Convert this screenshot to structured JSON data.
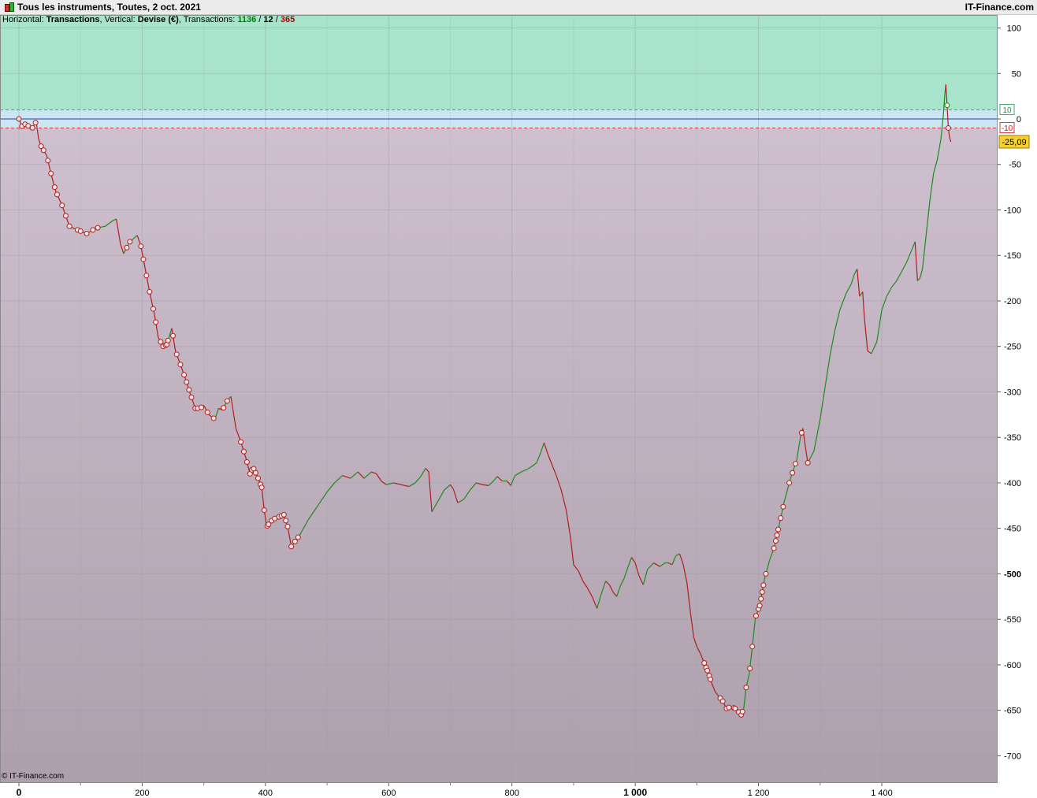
{
  "window": {
    "title": "Tous les instruments, Toutes, 2 oct. 2021",
    "brand": "IT-Finance.com",
    "copyright": "© IT-Finance.com"
  },
  "header": {
    "horizontal_label": "Horizontal: ",
    "horizontal_value": "Transactions",
    "vertical_label": ", Vertical: ",
    "vertical_value": "Devise (€)",
    "transactions_label": ", Transactions: ",
    "count_win": "1136",
    "sep1": " / ",
    "count_neutral": "12",
    "sep2": " / ",
    "count_loss": "365"
  },
  "chart_data": {
    "type": "line",
    "title": "Tous les instruments, Toutes, 2 oct. 2021",
    "xlabel": "Transactions",
    "ylabel": "Devise (€)",
    "xlim": [
      -30,
      1550
    ],
    "ylim": [
      -725,
      115
    ],
    "x_ticks": [
      {
        "v": 0,
        "label": "0",
        "bold": true
      },
      {
        "v": 200,
        "label": "200"
      },
      {
        "v": 400,
        "label": "400"
      },
      {
        "v": 600,
        "label": "600"
      },
      {
        "v": 800,
        "label": "800"
      },
      {
        "v": 1000,
        "label": "1 000",
        "bold": true
      },
      {
        "v": 1200,
        "label": "1 200"
      },
      {
        "v": 1400,
        "label": "1 400"
      }
    ],
    "x_minor_ticks": [
      100,
      300,
      500,
      700,
      900,
      1100,
      1300
    ],
    "y_ticks": [
      {
        "v": 100,
        "label": "100"
      },
      {
        "v": 50,
        "label": "50"
      },
      {
        "v": 0,
        "label": "0"
      },
      {
        "v": -50,
        "label": "-50"
      },
      {
        "v": -100,
        "label": "-100"
      },
      {
        "v": -150,
        "label": "-150"
      },
      {
        "v": -200,
        "label": "-200"
      },
      {
        "v": -250,
        "label": "-250"
      },
      {
        "v": -300,
        "label": "-300"
      },
      {
        "v": -350,
        "label": "-350"
      },
      {
        "v": -400,
        "label": "-400"
      },
      {
        "v": -450,
        "label": "-450"
      },
      {
        "v": -500,
        "label": "-500",
        "bold": true
      },
      {
        "v": -550,
        "label": "-550"
      },
      {
        "v": -600,
        "label": "-600"
      },
      {
        "v": -650,
        "label": "-650"
      },
      {
        "v": -700,
        "label": "-700"
      }
    ],
    "profit_band": 10,
    "loss_band": -10,
    "profit_band_label": "10",
    "loss_band_label": "-10",
    "last_value": -25.09,
    "last_value_label": "-25,09",
    "grid": true,
    "colors": {
      "profit_zone": "#a8e4cc",
      "loss_zone_top": "#cfc0cf",
      "loss_zone_bottom": "#ad9fac",
      "neutral_zone": "#cce6f4",
      "up": "#1e8a1e",
      "down": "#b01e1e",
      "marker_fill": "#f4e4e4",
      "value_badge": "#f6d230"
    },
    "series": [
      {
        "points": [
          [
            0,
            0
          ],
          [
            5,
            -8
          ],
          [
            12,
            -5
          ],
          [
            20,
            -12
          ],
          [
            28,
            -3
          ],
          [
            32,
            -22
          ],
          [
            36,
            -30
          ],
          [
            45,
            -40
          ],
          [
            52,
            -60
          ],
          [
            60,
            -80
          ],
          [
            70,
            -95
          ],
          [
            82,
            -118
          ],
          [
            95,
            -122
          ],
          [
            110,
            -126
          ],
          [
            125,
            -120
          ],
          [
            140,
            -118
          ],
          [
            152,
            -112
          ],
          [
            158,
            -110
          ],
          [
            165,
            -138
          ],
          [
            170,
            -148
          ],
          [
            180,
            -135
          ],
          [
            192,
            -128
          ],
          [
            198,
            -140
          ],
          [
            205,
            -165
          ],
          [
            212,
            -190
          ],
          [
            220,
            -215
          ],
          [
            226,
            -240
          ],
          [
            234,
            -250
          ],
          [
            240,
            -248
          ],
          [
            248,
            -230
          ],
          [
            254,
            -255
          ],
          [
            262,
            -270
          ],
          [
            270,
            -285
          ],
          [
            278,
            -302
          ],
          [
            286,
            -318
          ],
          [
            294,
            -318
          ],
          [
            300,
            -315
          ],
          [
            308,
            -325
          ],
          [
            318,
            -330
          ],
          [
            324,
            -318
          ],
          [
            330,
            -320
          ],
          [
            338,
            -310
          ],
          [
            344,
            -305
          ],
          [
            352,
            -340
          ],
          [
            360,
            -355
          ],
          [
            368,
            -372
          ],
          [
            375,
            -390
          ],
          [
            380,
            -383
          ],
          [
            388,
            -395
          ],
          [
            394,
            -405
          ],
          [
            398,
            -430
          ],
          [
            402,
            -448
          ],
          [
            412,
            -440
          ],
          [
            420,
            -438
          ],
          [
            430,
            -435
          ],
          [
            436,
            -448
          ],
          [
            442,
            -470
          ],
          [
            455,
            -458
          ],
          [
            470,
            -440
          ],
          [
            485,
            -425
          ],
          [
            500,
            -410
          ],
          [
            512,
            -400
          ],
          [
            525,
            -392
          ],
          [
            538,
            -395
          ],
          [
            550,
            -388
          ],
          [
            560,
            -395
          ],
          [
            572,
            -388
          ],
          [
            580,
            -390
          ],
          [
            588,
            -398
          ],
          [
            596,
            -402
          ],
          [
            608,
            -400
          ],
          [
            620,
            -402
          ],
          [
            633,
            -404
          ],
          [
            643,
            -400
          ],
          [
            652,
            -393
          ],
          [
            660,
            -384
          ],
          [
            665,
            -388
          ],
          [
            670,
            -432
          ],
          [
            680,
            -420
          ],
          [
            690,
            -408
          ],
          [
            700,
            -402
          ],
          [
            705,
            -407
          ],
          [
            712,
            -422
          ],
          [
            722,
            -418
          ],
          [
            732,
            -408
          ],
          [
            742,
            -400
          ],
          [
            752,
            -402
          ],
          [
            762,
            -403
          ],
          [
            770,
            -398
          ],
          [
            776,
            -393
          ],
          [
            784,
            -398
          ],
          [
            792,
            -398
          ],
          [
            798,
            -403
          ],
          [
            805,
            -392
          ],
          [
            815,
            -388
          ],
          [
            825,
            -385
          ],
          [
            832,
            -382
          ],
          [
            840,
            -378
          ],
          [
            846,
            -368
          ],
          [
            852,
            -356
          ],
          [
            858,
            -368
          ],
          [
            866,
            -382
          ],
          [
            872,
            -392
          ],
          [
            880,
            -408
          ],
          [
            888,
            -430
          ],
          [
            895,
            -460
          ],
          [
            900,
            -490
          ],
          [
            908,
            -497
          ],
          [
            915,
            -508
          ],
          [
            922,
            -515
          ],
          [
            930,
            -525
          ],
          [
            938,
            -538
          ],
          [
            945,
            -522
          ],
          [
            952,
            -508
          ],
          [
            958,
            -512
          ],
          [
            964,
            -520
          ],
          [
            970,
            -525
          ],
          [
            976,
            -513
          ],
          [
            982,
            -505
          ],
          [
            988,
            -493
          ],
          [
            994,
            -482
          ],
          [
            1000,
            -488
          ],
          [
            1006,
            -502
          ],
          [
            1013,
            -512
          ],
          [
            1020,
            -495
          ],
          [
            1030,
            -488
          ],
          [
            1040,
            -492
          ],
          [
            1048,
            -488
          ],
          [
            1054,
            -488
          ],
          [
            1060,
            -490
          ],
          [
            1066,
            -480
          ],
          [
            1072,
            -478
          ],
          [
            1078,
            -490
          ],
          [
            1084,
            -510
          ],
          [
            1090,
            -545
          ],
          [
            1095,
            -570
          ],
          [
            1100,
            -580
          ],
          [
            1106,
            -588
          ],
          [
            1112,
            -598
          ],
          [
            1118,
            -608
          ],
          [
            1124,
            -620
          ],
          [
            1130,
            -630
          ],
          [
            1136,
            -635
          ],
          [
            1142,
            -640
          ],
          [
            1148,
            -648
          ],
          [
            1156,
            -646
          ],
          [
            1162,
            -648
          ],
          [
            1168,
            -652
          ],
          [
            1172,
            -655
          ],
          [
            1176,
            -648
          ],
          [
            1180,
            -625
          ],
          [
            1185,
            -610
          ],
          [
            1190,
            -580
          ],
          [
            1195,
            -548
          ],
          [
            1202,
            -535
          ],
          [
            1210,
            -505
          ],
          [
            1218,
            -485
          ],
          [
            1226,
            -470
          ],
          [
            1234,
            -445
          ],
          [
            1242,
            -420
          ],
          [
            1252,
            -395
          ],
          [
            1262,
            -375
          ],
          [
            1268,
            -350
          ],
          [
            1272,
            -340
          ],
          [
            1276,
            -360
          ],
          [
            1280,
            -378
          ],
          [
            1290,
            -365
          ],
          [
            1300,
            -330
          ],
          [
            1308,
            -295
          ],
          [
            1316,
            -260
          ],
          [
            1324,
            -232
          ],
          [
            1332,
            -210
          ],
          [
            1342,
            -192
          ],
          [
            1350,
            -182
          ],
          [
            1356,
            -170
          ],
          [
            1360,
            -165
          ],
          [
            1364,
            -195
          ],
          [
            1369,
            -190
          ],
          [
            1372,
            -220
          ],
          [
            1377,
            -255
          ],
          [
            1383,
            -258
          ],
          [
            1392,
            -245
          ],
          [
            1400,
            -210
          ],
          [
            1408,
            -195
          ],
          [
            1416,
            -185
          ],
          [
            1424,
            -178
          ],
          [
            1432,
            -168
          ],
          [
            1440,
            -158
          ],
          [
            1448,
            -145
          ],
          [
            1454,
            -135
          ],
          [
            1458,
            -178
          ],
          [
            1462,
            -175
          ],
          [
            1466,
            -165
          ],
          [
            1470,
            -140
          ],
          [
            1474,
            -115
          ],
          [
            1478,
            -90
          ],
          [
            1484,
            -60
          ],
          [
            1490,
            -45
          ],
          [
            1496,
            -22
          ],
          [
            1500,
            5
          ],
          [
            1502,
            25
          ],
          [
            1504,
            38
          ],
          [
            1506,
            15
          ],
          [
            1508,
            -10
          ],
          [
            1510,
            -20
          ],
          [
            1512,
            -25.09
          ]
        ]
      }
    ],
    "markers_x": [
      0,
      5,
      10,
      15,
      22,
      27,
      36,
      40,
      47,
      52,
      58,
      62,
      70,
      76,
      82,
      95,
      100,
      110,
      120,
      128,
      175,
      180,
      198,
      202,
      207,
      212,
      218,
      222,
      230,
      234,
      238,
      240,
      242,
      250,
      256,
      262,
      268,
      272,
      276,
      280,
      286,
      290,
      296,
      306,
      316,
      332,
      338,
      360,
      365,
      370,
      375,
      378,
      381,
      384,
      388,
      392,
      394,
      398,
      403,
      405,
      410,
      415,
      422,
      426,
      430,
      433,
      436,
      442,
      448,
      453,
      1112,
      1115,
      1117,
      1120,
      1122,
      1138,
      1142,
      1148,
      1152,
      1160,
      1162,
      1168,
      1172,
      1174,
      1180,
      1186,
      1190,
      1196,
      1200,
      1202,
      1204,
      1206,
      1208,
      1212,
      1225,
      1228,
      1230,
      1232,
      1236,
      1240,
      1250,
      1255,
      1260,
      1270,
      1280,
      1506,
      1508
    ]
  }
}
